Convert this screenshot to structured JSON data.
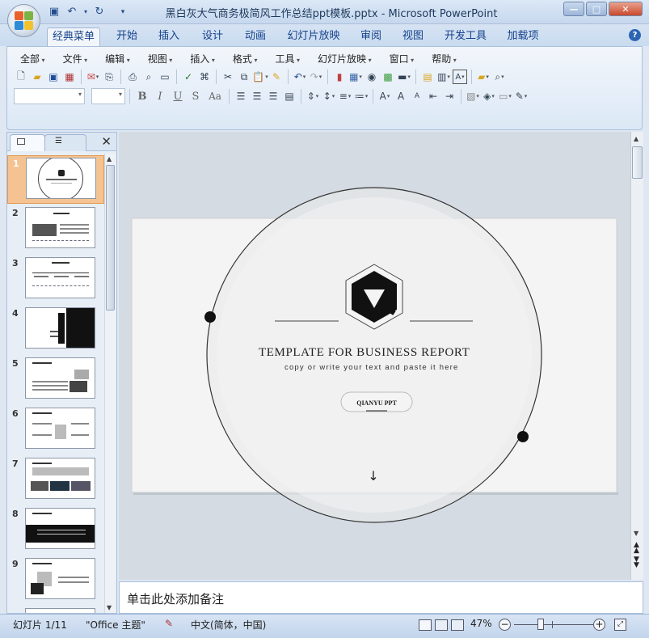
{
  "window": {
    "title": "黑白灰大气商务极简风工作总结ppt模板.pptx - Microsoft PowerPoint"
  },
  "tabs": [
    {
      "label": "经典菜单",
      "active": true
    },
    {
      "label": "开始"
    },
    {
      "label": "插入"
    },
    {
      "label": "设计"
    },
    {
      "label": "动画"
    },
    {
      "label": "幻灯片放映"
    },
    {
      "label": "审阅"
    },
    {
      "label": "视图"
    },
    {
      "label": "开发工具"
    },
    {
      "label": "加载项"
    }
  ],
  "menu": [
    "全部",
    "文件",
    "编辑",
    "视图",
    "插入",
    "格式",
    "工具",
    "幻灯片放映",
    "窗口",
    "帮助"
  ],
  "thumbnails": [
    "1",
    "2",
    "3",
    "4",
    "5",
    "6",
    "7",
    "8",
    "9"
  ],
  "slide": {
    "title": "TEMPLATE FOR BUSINESS REPORT",
    "subtitle": "copy or write your text and paste it here",
    "button": "QIANYU PPT",
    "arrow": "↓"
  },
  "notes": {
    "placeholder": "单击此处添加备注"
  },
  "status": {
    "slide_count": "幻灯片 1/11",
    "theme": "\"Office 主题\"",
    "language": "中文(简体，中国)",
    "zoom": "47%",
    "zoom_value": 47
  },
  "colors": {
    "selected_thumbnail": "#f5c392",
    "accent": "#15428b"
  }
}
